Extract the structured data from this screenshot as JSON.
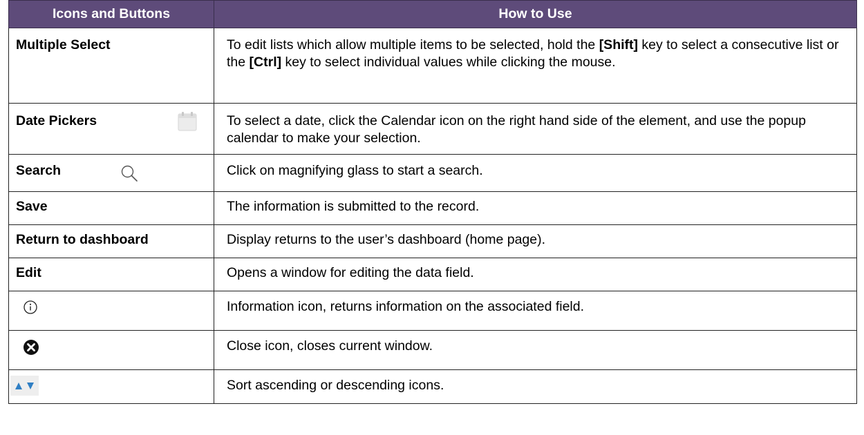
{
  "header": {
    "col1": "Icons and Buttons",
    "col2": "How to Use"
  },
  "rows": [
    {
      "name": "Multiple Select",
      "desc": {
        "p1": "To edit lists which allow multiple items to be selected, hold the ",
        "b1": "[Shift]",
        "p2": " key to select a consecutive list or the ",
        "b2": "[Ctrl]",
        "p3": " key to select individual values while clicking the mouse."
      }
    },
    {
      "name": "Date Pickers",
      "icon": "calendar-icon",
      "desc": "To select a date, click the Calendar icon on the right hand side of the element, and use the popup calendar to make your selection."
    },
    {
      "name": "Search",
      "icon": "magnifier-icon",
      "desc": "Click on magnifying glass to start a search."
    },
    {
      "name": "Save",
      "desc": "The information is submitted to the record."
    },
    {
      "name": "Return to dashboard",
      "desc": "Display returns to the user’s dashboard (home page)."
    },
    {
      "name": "Edit",
      "desc": "Opens a window for editing the data field."
    },
    {
      "icon": "info-icon",
      "desc": "Information icon, returns information on the associated field."
    },
    {
      "icon": "close-icon",
      "desc": "Close icon, closes current window."
    },
    {
      "icon": "sort-arrows-icon",
      "desc": "Sort ascending or descending icons."
    }
  ],
  "colors": {
    "header_bg": "#5e4b7a",
    "header_text": "#ffffff",
    "sort_arrow": "#2f7fc4"
  }
}
